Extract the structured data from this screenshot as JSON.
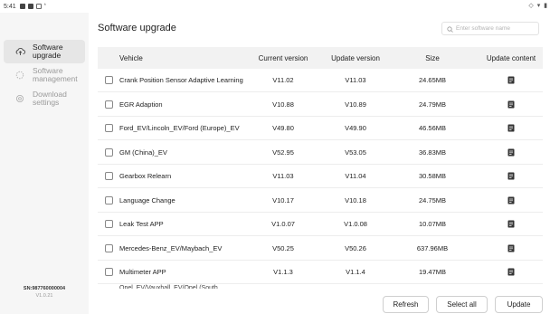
{
  "status_bar": {
    "time": "5:41",
    "extra": "* ",
    "right": "◇ ▾ ▮"
  },
  "sidebar": {
    "items": [
      {
        "label": "Software upgrade",
        "icon": "cloud-upload-icon",
        "active": true
      },
      {
        "label": "Software management",
        "icon": "loading-icon",
        "active": false
      },
      {
        "label": "Download settings",
        "icon": "gear-icon",
        "active": false
      }
    ],
    "serial": "SN:987760000004",
    "version": "V1.0.21"
  },
  "header": {
    "title": "Software upgrade",
    "search_placeholder": "Enter software name"
  },
  "table": {
    "columns": [
      "Vehicle",
      "Current version",
      "Update version",
      "Size",
      "Update content"
    ],
    "rows": [
      {
        "vehicle": "Crank Position Sensor Adaptive Learning",
        "current": "V11.02",
        "update": "V11.03",
        "size": "24.65MB"
      },
      {
        "vehicle": "EGR Adaption",
        "current": "V10.88",
        "update": "V10.89",
        "size": "24.79MB"
      },
      {
        "vehicle": "Ford_EV/Lincoln_EV/Ford (Europe)_EV",
        "current": "V49.80",
        "update": "V49.90",
        "size": "46.56MB"
      },
      {
        "vehicle": "GM (China)_EV",
        "current": "V52.95",
        "update": "V53.05",
        "size": "36.83MB"
      },
      {
        "vehicle": "Gearbox Relearn",
        "current": "V11.03",
        "update": "V11.04",
        "size": "30.58MB"
      },
      {
        "vehicle": "Language Change",
        "current": "V10.17",
        "update": "V10.18",
        "size": "24.75MB"
      },
      {
        "vehicle": "Leak Test APP",
        "current": "V1.0.07",
        "update": "V1.0.08",
        "size": "10.07MB"
      },
      {
        "vehicle": "Mercedes-Benz_EV/Maybach_EV",
        "current": "V50.25",
        "update": "V50.26",
        "size": "637.96MB"
      },
      {
        "vehicle": "Multimeter APP",
        "current": "V1.1.3",
        "update": "V1.1.4",
        "size": "19.47MB"
      },
      {
        "vehicle": "Opel_EV/Vauxhall_EV/Opel (South",
        "current": "",
        "update": "",
        "size": ""
      }
    ]
  },
  "buttons": {
    "refresh": "Refresh",
    "select_all": "Select all",
    "update": "Update"
  }
}
